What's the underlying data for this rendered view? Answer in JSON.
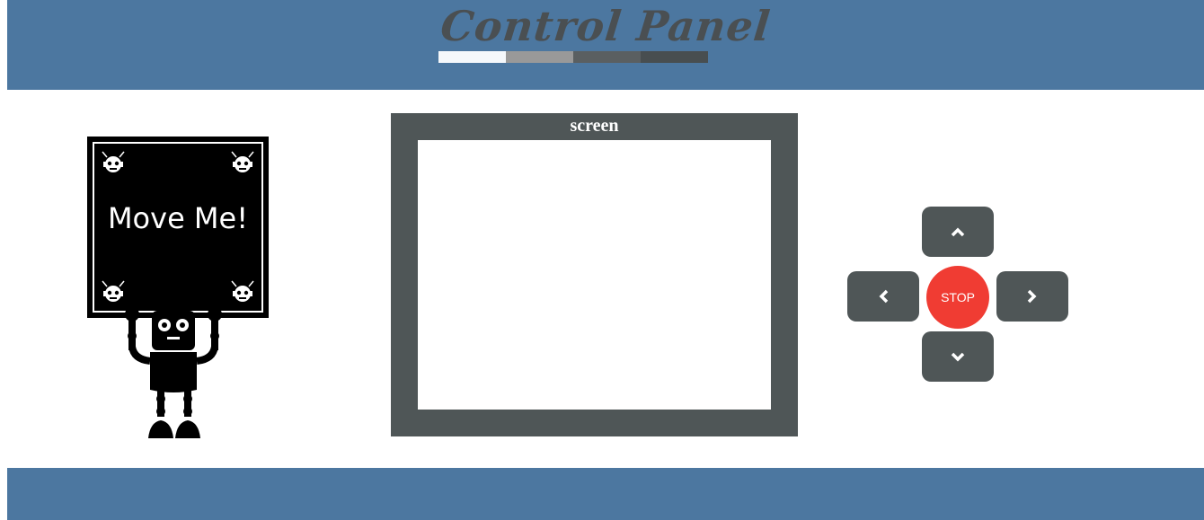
{
  "header": {
    "title": "Control Panel",
    "bar_colors": [
      "#f5f8fb",
      "#999999",
      "#5a5f61",
      "#484e50"
    ],
    "background": "#4c77a0"
  },
  "robot": {
    "sign_text": "Move Me!",
    "icon": "robot-holding-sign-icon"
  },
  "screen": {
    "label": "screen"
  },
  "controls": {
    "up_icon": "chevron-up-icon",
    "down_icon": "chevron-down-icon",
    "left_icon": "chevron-left-icon",
    "right_icon": "chevron-right-icon",
    "stop_label": "STOP",
    "stop_color": "#f03c33",
    "button_color": "#4f5657"
  },
  "footer": {
    "background": "#4c77a0"
  }
}
